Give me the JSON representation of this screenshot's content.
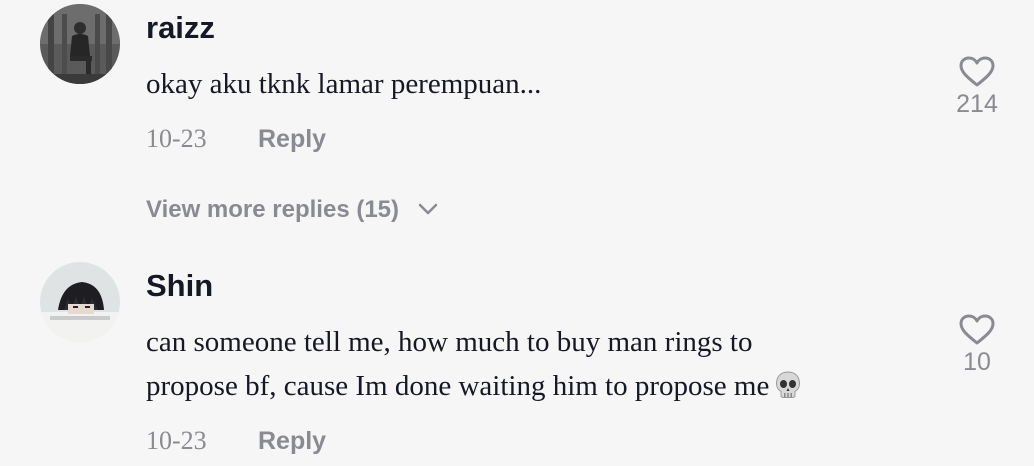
{
  "comments": [
    {
      "username": "raizz",
      "text": "okay aku tknk lamar perempuan...",
      "date": "10-23",
      "reply_label": "Reply",
      "likes": "214",
      "avatar_icon": "avatar-person-sitting-icon"
    },
    {
      "username": "Shin",
      "text_line1": "can someone tell me, how much to buy man rings to",
      "text_line2": "propose bf, cause Im done waiting him to propose me",
      "emoji": "skull-emoji",
      "date": "10-23",
      "reply_label": "Reply",
      "likes": "10",
      "avatar_icon": "avatar-anime-character-icon"
    }
  ],
  "view_more": {
    "label": "View more replies (15)"
  },
  "colors": {
    "background": "#f6f6f6",
    "text_primary": "#161823",
    "text_secondary": "#8a8b91"
  }
}
